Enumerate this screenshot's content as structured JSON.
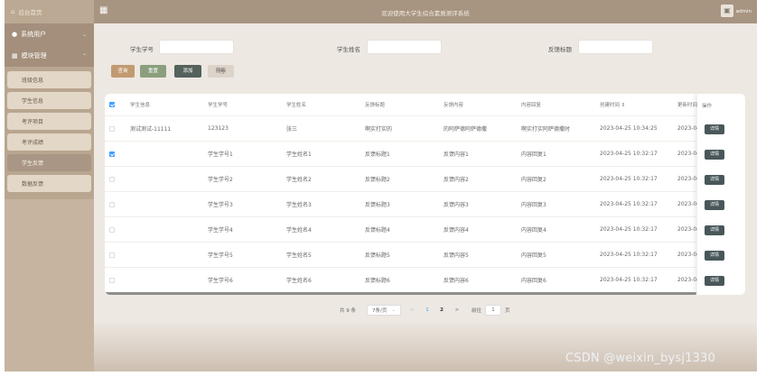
{
  "sidebar": {
    "home": "后台首页",
    "groups": [
      {
        "label": "系统用户"
      },
      {
        "label": "模块管理"
      }
    ],
    "items": [
      "班级信息",
      "学生信息",
      "考评项目",
      "考评成绩",
      "学生反馈",
      "数据反馈"
    ],
    "active_item": "学生反馈"
  },
  "header": {
    "title": "欢迎使用大学生综合素质测评系统",
    "user": "admin"
  },
  "search": {
    "student_no_label": "学生学号",
    "student_name_label": "学生姓名",
    "feedback_title_label": "反馈标题"
  },
  "toolbar": {
    "search_label": "查询",
    "reset_label": "重置",
    "add_label": "添加",
    "delete_label": "删除"
  },
  "table": {
    "columns": [
      "学生信息",
      "学生学号",
      "学生姓名",
      "反馈标题",
      "反馈内容",
      "内容回复",
      "创建时间 ⇕",
      "更新时间",
      "操作"
    ],
    "rows": [
      {
        "info": "测试测试-11111",
        "no": "123123",
        "name": "张三",
        "title": "啊实打实的",
        "content": "的阿萨德阿萨德撒",
        "reply": "啊实打实阿萨德撒时",
        "created": "2023-04-25 10:34:25",
        "updated": "2023-04",
        "checked": false
      },
      {
        "info": "",
        "no": "学生学号1",
        "name": "学生姓名1",
        "title": "反馈标题1",
        "content": "反馈内容1",
        "reply": "内容回复1",
        "created": "2023-04-25 10:32:17",
        "updated": "2023-04",
        "checked": true
      },
      {
        "info": "",
        "no": "学生学号2",
        "name": "学生姓名2",
        "title": "反馈标题2",
        "content": "反馈内容2",
        "reply": "内容回复2",
        "created": "2023-04-25 10:32:17",
        "updated": "2023-04",
        "checked": false
      },
      {
        "info": "",
        "no": "学生学号3",
        "name": "学生姓名3",
        "title": "反馈标题3",
        "content": "反馈内容3",
        "reply": "内容回复3",
        "created": "2023-04-25 10:32:17",
        "updated": "2023-04",
        "checked": false
      },
      {
        "info": "",
        "no": "学生学号4",
        "name": "学生姓名4",
        "title": "反馈标题4",
        "content": "反馈内容4",
        "reply": "内容回复4",
        "created": "2023-04-25 10:32:17",
        "updated": "2023-04",
        "checked": false
      },
      {
        "info": "",
        "no": "学生学号5",
        "name": "学生姓名5",
        "title": "反馈标题5",
        "content": "反馈内容5",
        "reply": "内容回复5",
        "created": "2023-04-25 10:32:17",
        "updated": "2023-04",
        "checked": false
      },
      {
        "info": "",
        "no": "学生学号6",
        "name": "学生姓名6",
        "title": "反馈标题6",
        "content": "反馈内容6",
        "reply": "内容回复6",
        "created": "2023-04-25 10:32:17",
        "updated": "2023-04",
        "checked": false
      }
    ],
    "detail_label": "详情"
  },
  "pagination": {
    "total": "共 9 条",
    "page_size": "7条/页",
    "prev": "<",
    "pages": [
      "1",
      "2"
    ],
    "current": "1",
    "next": ">",
    "goto_label": "前往",
    "goto_value": "1",
    "page_suffix": "页"
  },
  "watermark": "CSDN @weixin_bysj1330",
  "colors": {
    "sidebar": "#c6b4a0",
    "header": "#a79481",
    "accent": "#409eff",
    "detail_button": "#49575a"
  }
}
